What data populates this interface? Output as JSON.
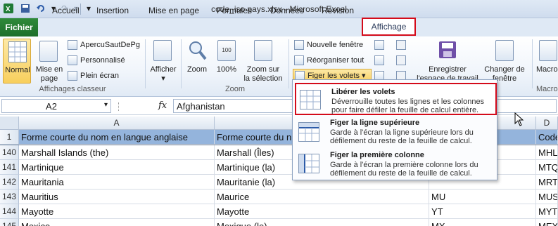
{
  "window": {
    "title": "code_iso pays.xlsx - Microsoft Excel"
  },
  "tabs": {
    "file": "Fichier",
    "items": [
      "Accueil",
      "Insertion",
      "Mise en page",
      "Formules",
      "Données",
      "Révision",
      "Affichage"
    ],
    "active": "Affichage"
  },
  "ribbon": {
    "group1": {
      "normal": "Normal",
      "mise_en_page": [
        "Mise en",
        "page"
      ],
      "apercu": "ApercuSautDePg",
      "personnalise": "Personnalisé",
      "plein_ecran": "Plein écran",
      "label": "Affichages classeur"
    },
    "group2": {
      "afficher": "Afficher"
    },
    "group3": {
      "zoom": "Zoom",
      "pct": "100%",
      "zoom_sel": [
        "Zoom sur",
        "la sélection"
      ],
      "label": "Zoom"
    },
    "group4": {
      "nouvelle": "Nouvelle fenêtre",
      "reorg": "Réorganiser tout",
      "figer": "Figer les volets",
      "enregistrer": [
        "Enregistrer",
        "l'espace de travail"
      ],
      "changer": [
        "Changer de",
        "fenêtre"
      ]
    },
    "group5": {
      "macros": "Macro",
      "label": "Macro"
    }
  },
  "formula_bar": {
    "name_box": "A2",
    "fx": "fx",
    "value": "Afghanistan"
  },
  "grid": {
    "columns": [
      "A",
      "B",
      "C",
      "D"
    ],
    "header_row": {
      "num": "1",
      "a": "Forme courte du nom en langue anglaise",
      "b": "Forme courte du n",
      "d": "Code"
    },
    "rows": [
      {
        "num": "140",
        "a": "Marshall Islands (the)",
        "b": "Marshall (Îles)",
        "c": "",
        "d": "MHL"
      },
      {
        "num": "141",
        "a": "Martinique",
        "b": "Martinique (la)",
        "c": "",
        "d": "MTQ"
      },
      {
        "num": "142",
        "a": "Mauritania",
        "b": "Mauritanie (la)",
        "c": "",
        "d": "MRT"
      },
      {
        "num": "143",
        "a": "Mauritius",
        "b": "Maurice",
        "c": "MU",
        "d": "MUS"
      },
      {
        "num": "144",
        "a": "Mayotte",
        "b": "Mayotte",
        "c": "YT",
        "d": "MYT"
      },
      {
        "num": "145",
        "a": "Mexico",
        "b": "Mexique (le)",
        "c": "MX",
        "d": "MEX"
      }
    ]
  },
  "dropdown": {
    "items": [
      {
        "title": "Libérer les volets",
        "desc": [
          "Déverrouille toutes les lignes et les colonnes",
          "pour faire défiler la feuille de calcul entière."
        ]
      },
      {
        "title": "Figer la ligne supérieure",
        "desc": [
          "Garde à l'écran la ligne supérieure lors du",
          "défilement du reste de la feuille de calcul."
        ]
      },
      {
        "title": "Figer la première colonne",
        "desc": [
          "Garde à l'écran la première colonne lors du",
          "défilement du reste de la feuille de calcul."
        ]
      }
    ]
  },
  "colors": {
    "highlight_red": "#d40b1a",
    "file_tab_green": "#1e6e2a",
    "header_row_blue": "#94b4dc"
  }
}
